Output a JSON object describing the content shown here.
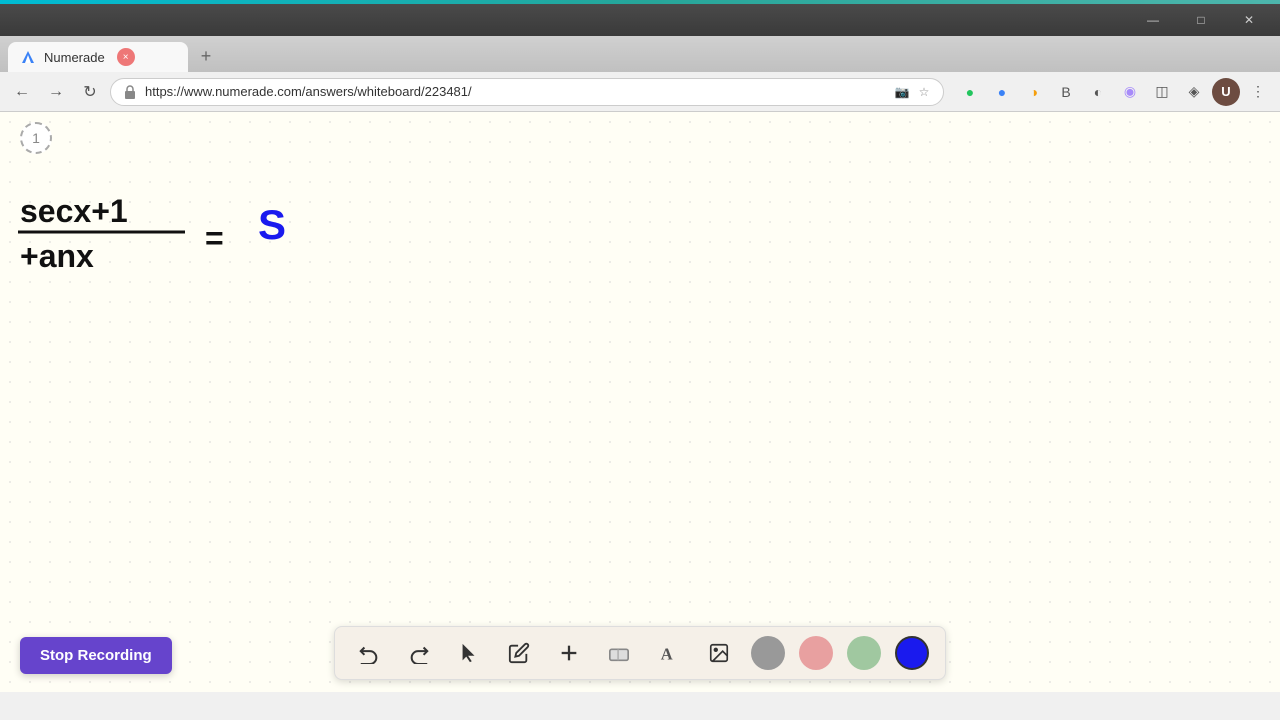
{
  "browser": {
    "tab_title": "Numerade",
    "tab_close_label": "×",
    "new_tab_label": "+",
    "url": "https://www.numerade.com/answers/whiteboard/223481/",
    "nav": {
      "back_icon": "←",
      "forward_icon": "→",
      "refresh_icon": "↻"
    },
    "window_controls": {
      "minimize": "—",
      "maximize": "□",
      "close": "✕"
    }
  },
  "page_number": "1",
  "toolbar": {
    "undo_label": "↺",
    "redo_label": "↻",
    "select_label": "▷",
    "pen_label": "✏",
    "add_label": "+",
    "eraser_label": "◫",
    "text_label": "A",
    "image_label": "🖼",
    "colors": [
      {
        "name": "gray",
        "hex": "#999999"
      },
      {
        "name": "pink",
        "hex": "#e8a0a0"
      },
      {
        "name": "green",
        "hex": "#a0c8a0"
      },
      {
        "name": "blue",
        "hex": "#1a1aee"
      }
    ]
  },
  "stop_recording": {
    "label": "Stop Recording"
  },
  "math": {
    "equation": "secx+1 / tanx = S"
  }
}
